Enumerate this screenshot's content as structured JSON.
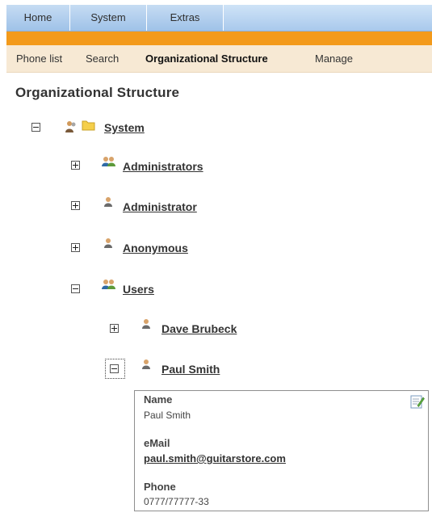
{
  "top_tabs": [
    "Home",
    "System",
    "Extras"
  ],
  "sub_nav": {
    "items": [
      "Phone list",
      "Search",
      "Organizational Structure",
      "Manage"
    ],
    "active": "Organizational Structure"
  },
  "page_title": "Organizational Structure",
  "tree": {
    "root": {
      "label": "System",
      "expanded": true
    },
    "children": [
      {
        "label": "Administrators",
        "type": "group",
        "expanded": false
      },
      {
        "label": "Administrator",
        "type": "user",
        "expanded": false
      },
      {
        "label": "Anonymous",
        "type": "user",
        "expanded": false
      },
      {
        "label": "Users",
        "type": "group",
        "expanded": true,
        "children": [
          {
            "label": "Dave Brubeck",
            "type": "user",
            "expanded": false
          },
          {
            "label": "Paul Smith",
            "type": "user",
            "expanded": true,
            "focused": true
          }
        ]
      }
    ]
  },
  "details": {
    "name_label": "Name",
    "name_value": "Paul Smith",
    "email_label": "eMail",
    "email_value": "paul.smith@guitarstore.com",
    "phone_label": "Phone",
    "phone_value": "0777/77777-33"
  },
  "colors": {
    "tab_bar": "#a9c9ec",
    "orange_strip": "#f39a1b",
    "subnav_bg": "#f7e9d4"
  }
}
